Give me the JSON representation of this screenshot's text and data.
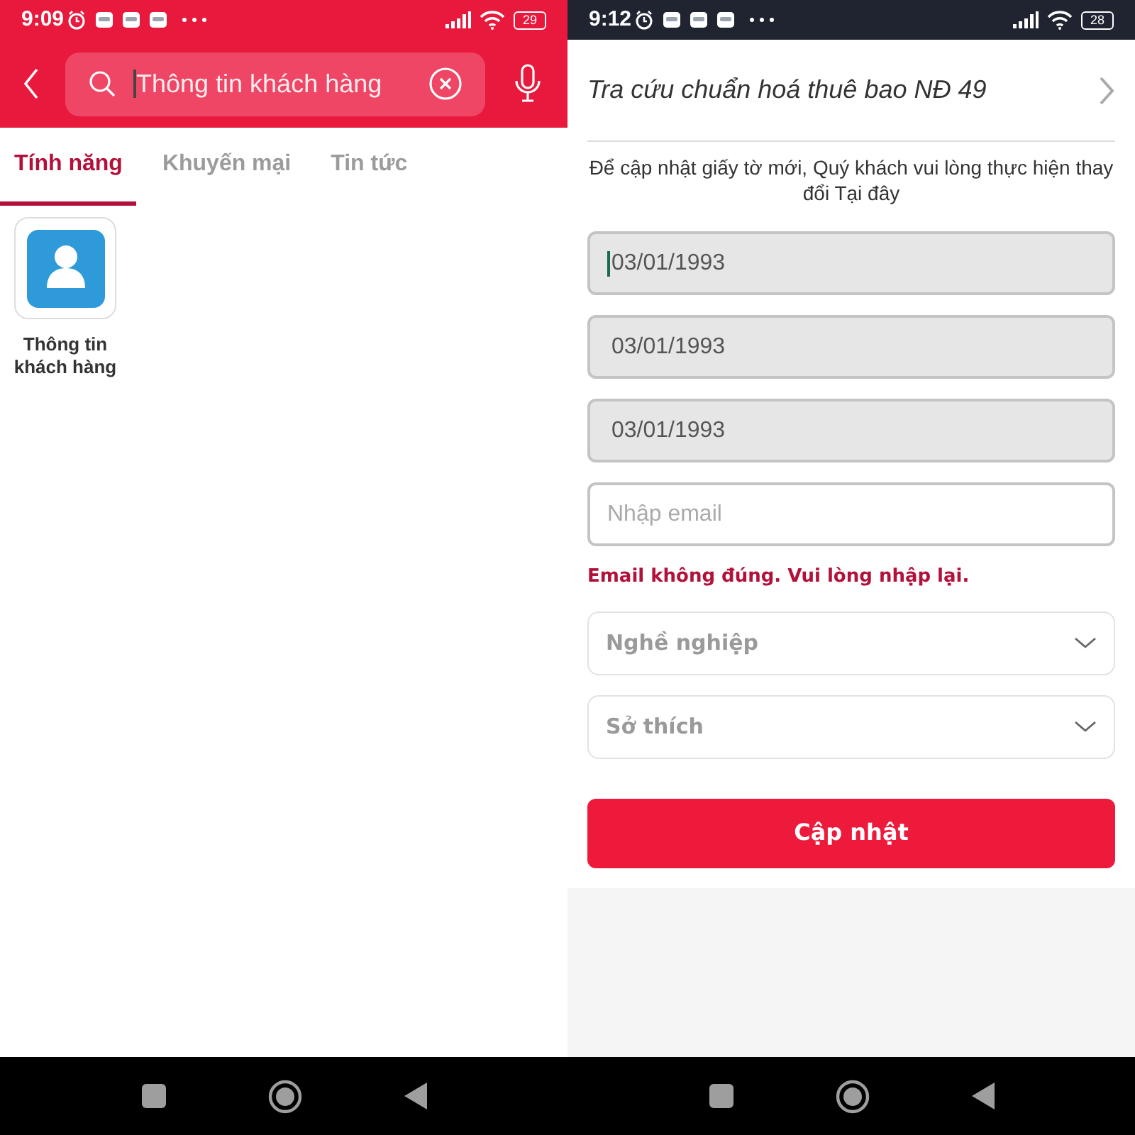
{
  "search_screen": {
    "status_bar": {
      "time": "9:09",
      "battery": "29"
    },
    "search": {
      "value": "Thông tin khách hàng",
      "focused": true
    },
    "tabs": [
      {
        "label": "Tính năng",
        "selected": true
      },
      {
        "label": "Khuyến mại",
        "selected": false
      },
      {
        "label": "Tin tức",
        "selected": false
      }
    ],
    "results": [
      {
        "label": "Thông tin khách hàng"
      }
    ]
  },
  "form_screen": {
    "status_bar": {
      "time": "9:12",
      "battery": "28"
    },
    "title": "Tra cứu chuẩn hoá thuê bao NĐ 49",
    "notice": "Để cập nhật giấy tờ mới, Quý khách vui lòng thực hiện thay đổi Tại đây",
    "fields": [
      {
        "kind": "date",
        "value": "03/01/1993",
        "focused": true
      },
      {
        "kind": "date",
        "value": "03/01/1993",
        "focused": false
      },
      {
        "kind": "date",
        "value": "03/01/1993",
        "focused": false
      },
      {
        "kind": "email",
        "placeholder": "Nhập email",
        "error": "Email không đúng. Vui lòng nhập lại."
      },
      {
        "kind": "select",
        "placeholder": "Nghề nghiệp"
      },
      {
        "kind": "select",
        "placeholder": "Sở thích"
      }
    ],
    "submit": "Cập nhật"
  }
}
